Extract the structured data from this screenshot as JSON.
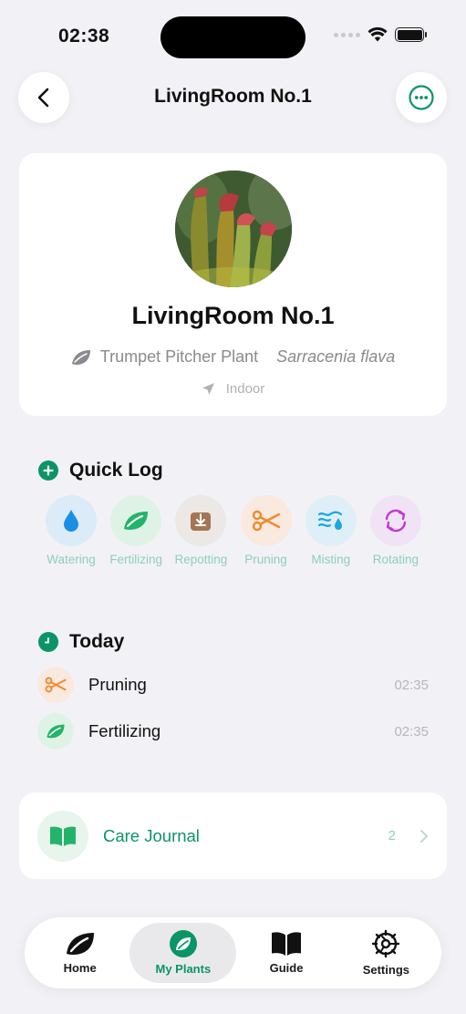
{
  "status_bar": {
    "time": "02:38"
  },
  "header": {
    "title": "LivingRoom No.1"
  },
  "plant": {
    "name": "LivingRoom No.1",
    "common_name": "Trumpet Pitcher Plant",
    "scientific_name": "Sarracenia flava",
    "location": "Indoor"
  },
  "quick_log": {
    "title": "Quick Log",
    "actions": [
      {
        "label": "Watering",
        "icon": "water-drop-icon",
        "bg": "#dcebf8",
        "color": "#1a8ee6"
      },
      {
        "label": "Fertilizing",
        "icon": "leaf-icon",
        "bg": "#def3e5",
        "color": "#24b36b"
      },
      {
        "label": "Repotting",
        "icon": "pot-icon",
        "bg": "#ece8e6",
        "color": "#a57556"
      },
      {
        "label": "Pruning",
        "icon": "scissors-icon",
        "bg": "#fae9df",
        "color": "#f08a2a"
      },
      {
        "label": "Misting",
        "icon": "mist-icon",
        "bg": "#dfeff8",
        "color": "#18a9dd"
      },
      {
        "label": "Rotating",
        "icon": "rotate-icon",
        "bg": "#f1e3f6",
        "color": "#c13ad6"
      }
    ]
  },
  "today": {
    "title": "Today",
    "entries": [
      {
        "name": "Pruning",
        "time": "02:35",
        "icon": "scissors-icon"
      },
      {
        "name": "Fertilizing",
        "time": "02:35",
        "icon": "leaf-icon"
      }
    ]
  },
  "care_journal": {
    "label": "Care Journal",
    "count": "2"
  },
  "tab_bar": {
    "tabs": [
      {
        "label": "Home",
        "icon": "leaf-icon"
      },
      {
        "label": "My Plants",
        "icon": "leaf-badge-icon",
        "active": true
      },
      {
        "label": "Guide",
        "icon": "book-icon"
      },
      {
        "label": "Settings",
        "icon": "gear-icon"
      }
    ]
  },
  "colors": {
    "accent": "#0b9466",
    "background": "#f2f2f6",
    "card": "#ffffff"
  }
}
